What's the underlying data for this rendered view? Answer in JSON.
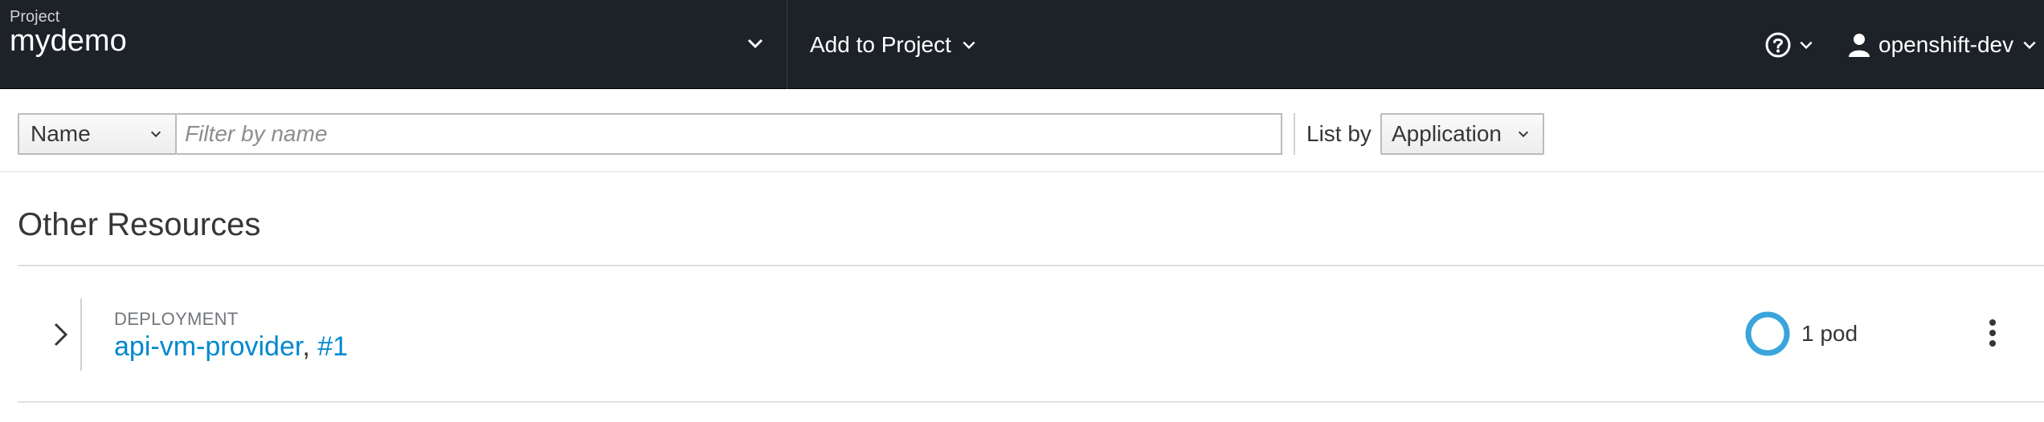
{
  "navbar": {
    "project_label": "Project",
    "project_name": "mydemo",
    "add_to_project": "Add to Project",
    "help_icon": "question-circle-icon",
    "username": "openshift-dev",
    "user_icon": "user-icon"
  },
  "filter_bar": {
    "filter_type": "Name",
    "filter_placeholder": "Filter by name",
    "filter_value": "",
    "list_by_label": "List by",
    "list_by_value": "Application"
  },
  "section": {
    "title": "Other Resources",
    "rows": [
      {
        "kind": "DEPLOYMENT",
        "name": "api-vm-provider",
        "separator": ", ",
        "revision": "#1",
        "pods": "1 pod",
        "pod_ratio": 1.0
      }
    ]
  },
  "colors": {
    "navbar_bg": "#1d2128",
    "link": "#0088ce",
    "donut": "#39a5dc"
  }
}
